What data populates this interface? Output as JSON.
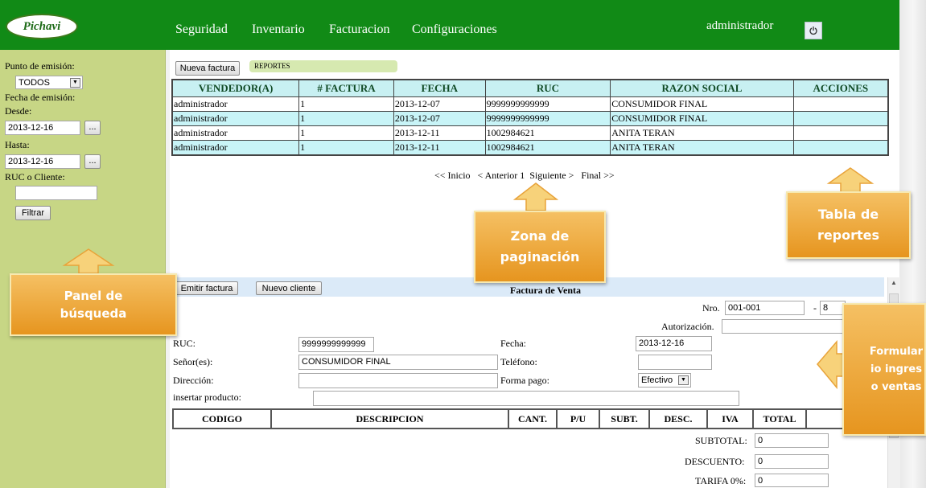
{
  "header": {
    "logo_text": "Pichavi",
    "menu": [
      {
        "label": "Seguridad"
      },
      {
        "label": "Inventario"
      },
      {
        "label": "Facturacion"
      },
      {
        "label": "Configuraciones"
      }
    ],
    "user": "administrador",
    "power_icon": "power-icon"
  },
  "filters": {
    "punto_label": "Punto de emisión:",
    "punto_value": "TODOS",
    "fecha_label": "Fecha de emisión:",
    "desde_label": "Desde:",
    "desde_value": "2013-12-16",
    "hasta_label": "Hasta:",
    "hasta_value": "2013-12-16",
    "date_btn": "...",
    "ruc_label": "RUC o Cliente:",
    "ruc_value": "",
    "filter_btn": "Filtrar"
  },
  "reports": {
    "new_invoice_btn": "Nueva factura",
    "tab_label": "REPORTES",
    "columns": [
      "VENDEDOR(A)",
      "# FACTURA",
      "FECHA",
      "RUC",
      "RAZON SOCIAL",
      "ACCIONES"
    ],
    "rows": [
      {
        "vendedor": "administrador",
        "factura": "1",
        "fecha": "2013-12-07",
        "ruc": "9999999999999",
        "razon": "CONSUMIDOR FINAL",
        "acciones": ""
      },
      {
        "vendedor": "administrador",
        "factura": "1",
        "fecha": "2013-12-07",
        "ruc": "9999999999999",
        "razon": "CONSUMIDOR FINAL",
        "acciones": ""
      },
      {
        "vendedor": "administrador",
        "factura": "1",
        "fecha": "2013-12-11",
        "ruc": "1002984621",
        "razon": "ANITA TERAN",
        "acciones": ""
      },
      {
        "vendedor": "administrador",
        "factura": "1",
        "fecha": "2013-12-11",
        "ruc": "1002984621",
        "razon": "ANITA TERAN",
        "acciones": ""
      }
    ]
  },
  "pager": {
    "first": "<< Inicio",
    "prev": "< Anterior",
    "page": "1",
    "next": "Siguiente >",
    "last": "Final >>"
  },
  "invoice": {
    "emit_btn": "Emitir factura",
    "new_client_btn": "Nuevo cliente",
    "title": "Factura de Venta",
    "nro_label": "Nro.",
    "nro_value": "001-001",
    "nro_sep": "-",
    "nro_seq": "8",
    "autorizacion_label": "Autorización.",
    "autorizacion_value": "",
    "ruc_label": "RUC:",
    "ruc_value": "9999999999999",
    "senor_label": "Señor(es):",
    "senor_value": "CONSUMIDOR FINAL",
    "direccion_label": "Dirección:",
    "direccion_value": "",
    "insertar_label": "insertar producto:",
    "insertar_value": "",
    "fecha_label": "Fecha:",
    "fecha_value": "2013-12-16",
    "telefono_label": "Teléfono:",
    "telefono_value": "",
    "forma_label": "Forma pago:",
    "forma_value": "Efectivo",
    "detail_columns": [
      "CODIGO",
      "DESCRIPCION",
      "CANT.",
      "P/U",
      "SUBT.",
      "DESC.",
      "IVA",
      "TOTAL",
      ""
    ],
    "subtotal_label": "SUBTOTAL:",
    "subtotal_value": "0",
    "descuento_label": "DESCUENTO:",
    "descuento_value": "0",
    "tarifa_label": "TARIFA 0%:",
    "tarifa_value": "0"
  },
  "callouts": {
    "panel": "Panel de búsqueda",
    "zona": "Zona de paginación",
    "tabla": "Tabla de reportes",
    "formulario": "Formulario ingreso ventas"
  },
  "colors": {
    "header_bg": "#118a16",
    "left_panel_bg": "#c7d685",
    "row_alt_bg": "#c8f4f7",
    "callout_orange": "#e6951f"
  }
}
